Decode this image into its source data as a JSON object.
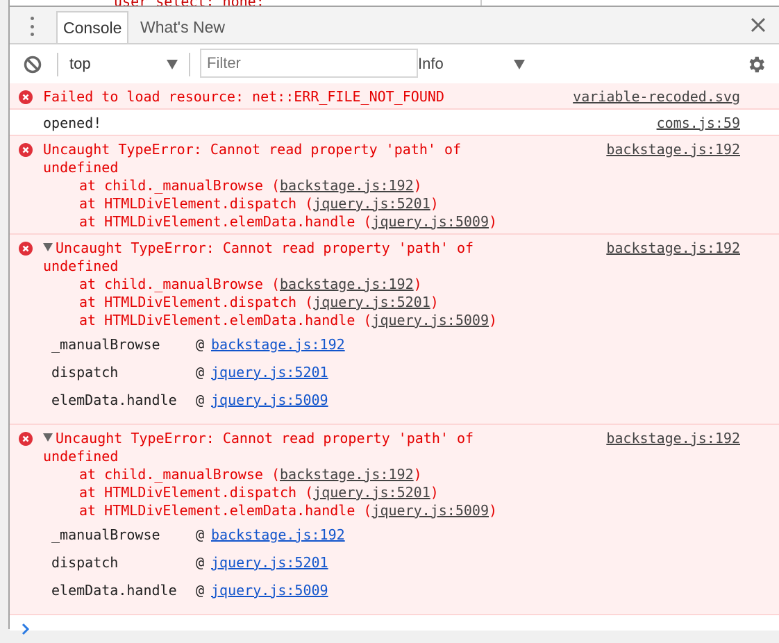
{
  "above_fragment": "user select: none;",
  "tabbar": {
    "tabs": [
      {
        "label": "Console",
        "active": true
      },
      {
        "label": "What's New",
        "active": false
      }
    ],
    "menu_icon": "more-vertical-icon",
    "close_icon": "close-icon"
  },
  "toolbar": {
    "clear_icon": "block-icon",
    "context_value": "top",
    "filter_placeholder": "Filter",
    "filter_value": "",
    "level_value": "Info",
    "settings_icon": "gear-icon"
  },
  "colors": {
    "error_text": "#e50000",
    "error_bg": "#fff0f0",
    "error_border": "#fdd6d6",
    "link_blue": "#1155cc",
    "prompt_blue": "#2a7ae2"
  },
  "messages": [
    {
      "type": "error",
      "text": "Failed to load resource: net::ERR_FILE_NOT_FOUND",
      "source": "variable-recoded.svg"
    },
    {
      "type": "log",
      "text": "opened!",
      "source": "coms.js:59"
    },
    {
      "type": "error",
      "text": "Uncaught TypeError: Cannot read property 'path' of",
      "text_cont": "undefined",
      "source": "backstage.js:192",
      "stack": [
        {
          "prefix": "at child._manualBrowse (",
          "link": "backstage.js:192",
          "suffix": ")"
        },
        {
          "prefix": "at HTMLDivElement.dispatch (",
          "link": "jquery.js:5201",
          "suffix": ")"
        },
        {
          "prefix": "at HTMLDivElement.elemData.handle (",
          "link": "jquery.js:5009",
          "suffix": ")"
        }
      ]
    },
    {
      "type": "error",
      "expanded": true,
      "text": "Uncaught TypeError: Cannot read property 'path' of",
      "text_cont": "undefined",
      "source": "backstage.js:192",
      "stack": [
        {
          "prefix": "at child._manualBrowse (",
          "link": "backstage.js:192",
          "suffix": ")"
        },
        {
          "prefix": "at HTMLDivElement.dispatch (",
          "link": "jquery.js:5201",
          "suffix": ")"
        },
        {
          "prefix": "at HTMLDivElement.elemData.handle (",
          "link": "jquery.js:5009",
          "suffix": ")"
        }
      ],
      "frames": [
        {
          "fn": "_manualBrowse",
          "at": "@",
          "link": "backstage.js:192"
        },
        {
          "fn": "dispatch",
          "at": "@",
          "link": "jquery.js:5201"
        },
        {
          "fn": "elemData.handle",
          "at": "@",
          "link": "jquery.js:5009"
        }
      ]
    },
    {
      "type": "error",
      "expanded": true,
      "text": "Uncaught TypeError: Cannot read property 'path' of",
      "text_cont": "undefined",
      "source": "backstage.js:192",
      "stack": [
        {
          "prefix": "at child._manualBrowse (",
          "link": "backstage.js:192",
          "suffix": ")"
        },
        {
          "prefix": "at HTMLDivElement.dispatch (",
          "link": "jquery.js:5201",
          "suffix": ")"
        },
        {
          "prefix": "at HTMLDivElement.elemData.handle (",
          "link": "jquery.js:5009",
          "suffix": ")"
        }
      ],
      "frames": [
        {
          "fn": "_manualBrowse",
          "at": "@",
          "link": "backstage.js:192"
        },
        {
          "fn": "dispatch",
          "at": "@",
          "link": "jquery.js:5201"
        },
        {
          "fn": "elemData.handle",
          "at": "@",
          "link": "jquery.js:5009"
        }
      ]
    }
  ],
  "prompt_icon": "chevron-right-icon"
}
